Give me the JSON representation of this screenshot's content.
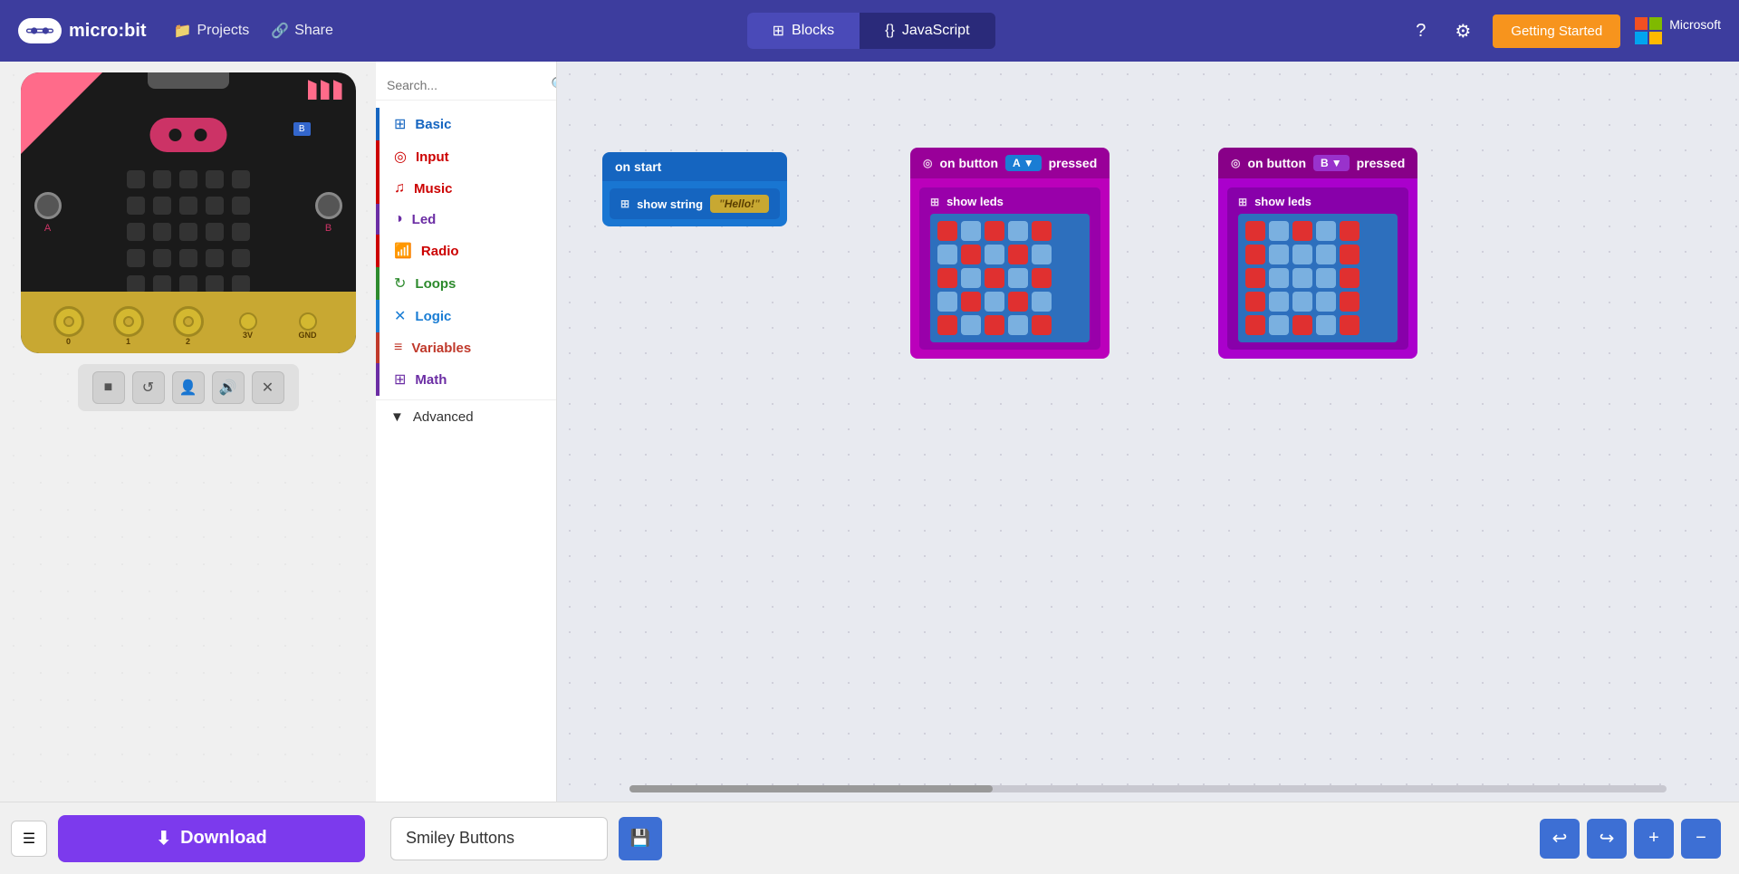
{
  "header": {
    "logo_text": "micro:bit",
    "nav_items": [
      {
        "label": "Projects",
        "icon": "📁"
      },
      {
        "label": "Share",
        "icon": "🔗"
      }
    ],
    "mode_blocks": "Blocks",
    "mode_js": "JavaScript",
    "getting_started": "Getting Started",
    "help_icon": "?",
    "settings_icon": "⚙"
  },
  "simulator": {
    "btn_a_label": "A",
    "btn_b_label": "B",
    "flag_b": "B",
    "pin_labels": [
      "0",
      "1",
      "2",
      "3V",
      "GND"
    ],
    "controls": [
      {
        "icon": "■",
        "label": "stop"
      },
      {
        "icon": "↺",
        "label": "restart"
      },
      {
        "icon": "👤",
        "label": "person"
      },
      {
        "icon": "🔊",
        "label": "sound"
      },
      {
        "icon": "✕",
        "label": "close"
      }
    ]
  },
  "categories": [
    {
      "label": "Basic",
      "color": "#1565C0",
      "icon": "⊞"
    },
    {
      "label": "Input",
      "color": "#cc0000",
      "icon": "◎"
    },
    {
      "label": "Music",
      "color": "#cc0000",
      "icon": "♫"
    },
    {
      "label": "Led",
      "color": "#6b2da4",
      "icon": "◑"
    },
    {
      "label": "Radio",
      "color": "#cc0000",
      "icon": "📶"
    },
    {
      "label": "Loops",
      "color": "#2d8a2d",
      "icon": "↻"
    },
    {
      "label": "Logic",
      "color": "#1a7dd4",
      "icon": "✕"
    },
    {
      "label": "Variables",
      "color": "#c0392b",
      "icon": "≡"
    },
    {
      "label": "Math",
      "color": "#6b2da4",
      "icon": "⊞"
    },
    {
      "label": "Advanced",
      "color": "#333",
      "icon": "▼"
    }
  ],
  "search_placeholder": "Search...",
  "blocks": {
    "on_start": {
      "header_label": "on start",
      "header_color": "#1565C0",
      "body_color": "#1976D2",
      "inner_label": "show string",
      "inner_color": "#1565C0",
      "string_value": "Hello!",
      "grid_icon": "⊞"
    },
    "btn_a": {
      "header_label": "on button",
      "selector_label": "A",
      "pressed_label": "pressed",
      "header_color": "#aa00aa",
      "body_color": "#cc00cc",
      "inner_label": "show leds",
      "leds": [
        1,
        0,
        1,
        0,
        1,
        0,
        1,
        0,
        1,
        0,
        1,
        0,
        1,
        0,
        1,
        0,
        1,
        0,
        1,
        0,
        1,
        0,
        1,
        0,
        1
      ]
    },
    "btn_b": {
      "header_label": "on button",
      "selector_label": "B",
      "pressed_label": "pressed",
      "header_color": "#aa00aa",
      "body_color": "#cc00cc",
      "inner_label": "show leds",
      "leds": [
        1,
        0,
        1,
        0,
        1,
        1,
        0,
        0,
        0,
        1,
        1,
        0,
        0,
        0,
        1,
        1,
        0,
        0,
        0,
        1,
        1,
        0,
        1,
        0,
        1
      ]
    }
  },
  "bottom": {
    "download_label": "Download",
    "project_name": "Smiley Buttons",
    "save_icon": "💾"
  }
}
